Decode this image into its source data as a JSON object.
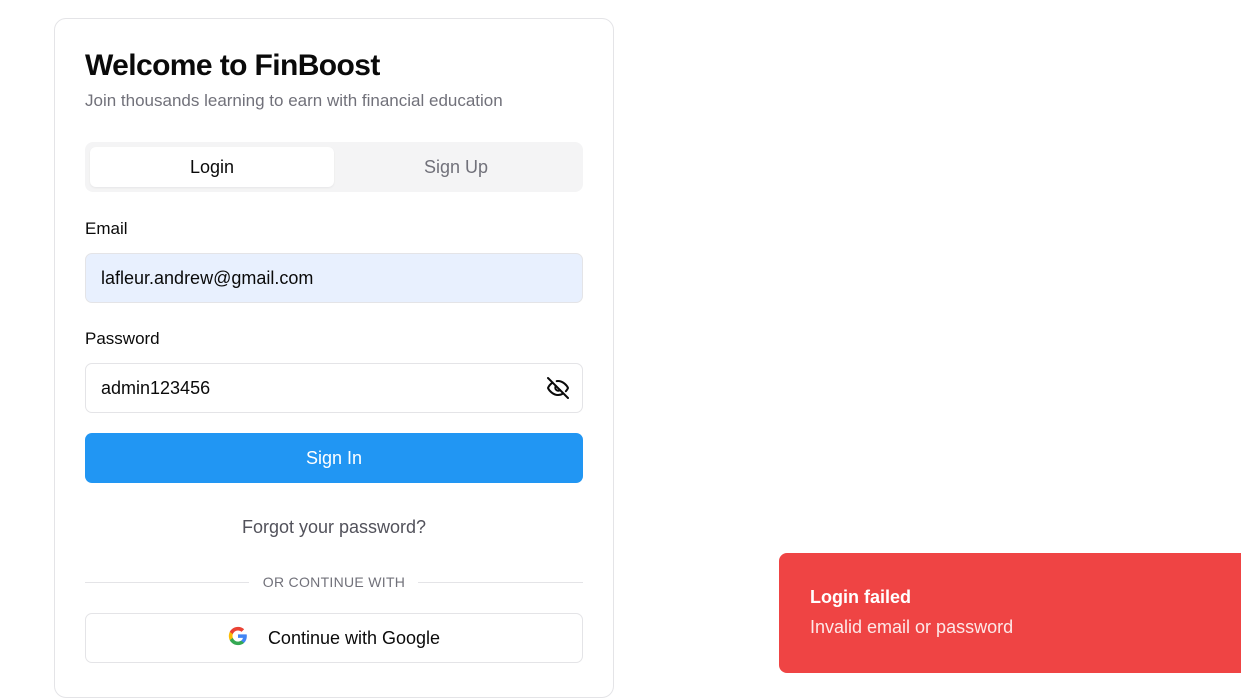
{
  "header": {
    "title": "Welcome to FinBoost",
    "subtitle": "Join thousands learning to earn with financial education"
  },
  "tabs": [
    {
      "label": "Login",
      "active": true
    },
    {
      "label": "Sign Up",
      "active": false
    }
  ],
  "form": {
    "email_label": "Email",
    "email_value": "lafleur.andrew@gmail.com",
    "password_label": "Password",
    "password_value": "admin123456",
    "password_toggle_icon": "eye-off-icon",
    "submit_label": "Sign In",
    "forgot_label": "Forgot your password?",
    "divider_text": "OR CONTINUE WITH",
    "google_label": "Continue with Google",
    "google_icon": "google-icon"
  },
  "toast": {
    "title": "Login failed",
    "message": "Invalid email or password",
    "color": "#ef4444"
  },
  "colors": {
    "primary": "#2196f3",
    "autofill_bg": "#e8f0fe"
  }
}
